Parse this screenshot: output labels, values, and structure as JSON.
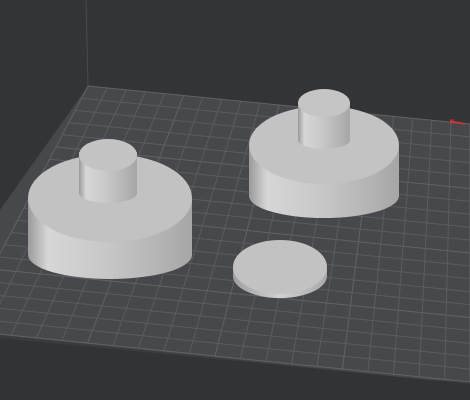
{
  "app": {
    "view": "3d-viewport"
  },
  "scene": {
    "background_color": "#333436",
    "bed": {
      "color": "#4b4c4f",
      "grid_line_color": "#56585b",
      "major_grid_line_color": "#5d5f62",
      "edge_color": "#2b2c2e"
    },
    "model_color": "#c7c7c7",
    "axis_indicator": {
      "x_color": "#e0323c",
      "label": "x"
    },
    "objects": [
      {
        "name": "stepped-cylinder-left",
        "type": "stepped-cylinder"
      },
      {
        "name": "stepped-cylinder-right",
        "type": "stepped-cylinder"
      },
      {
        "name": "flat-disc",
        "type": "disc"
      }
    ]
  }
}
